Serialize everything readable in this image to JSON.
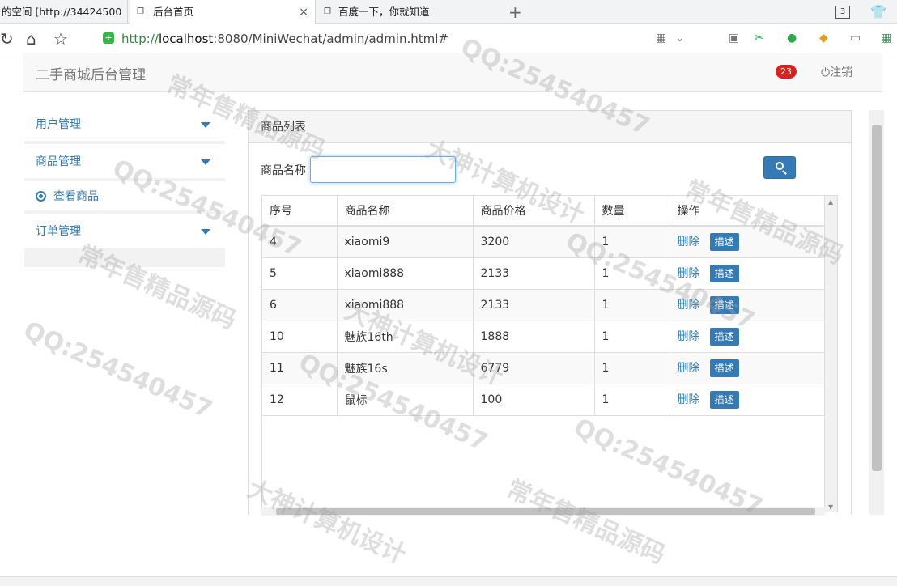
{
  "browser": {
    "tabs": [
      {
        "label": "的空间 [http://34424500"
      },
      {
        "label": "后台首页",
        "close": "×"
      },
      {
        "label": "百度一下，你就知道"
      }
    ],
    "new_tab": "+",
    "tab_count": "3",
    "url_prefix": "http://",
    "url_host": "localhost",
    "url_rest": ":8080/MiniWechat/admin/admin.html#"
  },
  "header": {
    "brand": "二手商城后台管理",
    "badge": "23",
    "logout": "注销"
  },
  "sidebar": {
    "items": [
      {
        "label": "用户管理"
      },
      {
        "label": "商品管理"
      },
      {
        "label": "查看商品"
      },
      {
        "label": "订单管理"
      }
    ]
  },
  "panel": {
    "title": "商品列表",
    "search_label": "商品名称",
    "search_value": ""
  },
  "table": {
    "headers": [
      "序号",
      "商品名称",
      "商品价格",
      "数量",
      "操作"
    ],
    "delete_label": "删除",
    "desc_label": "描述",
    "rows": [
      {
        "id": "4",
        "name": "xiaomi9",
        "price": "3200",
        "qty": "1"
      },
      {
        "id": "5",
        "name": "xiaomi888",
        "price": "2133",
        "qty": "1"
      },
      {
        "id": "6",
        "name": "xiaomi888",
        "price": "2133",
        "qty": "1"
      },
      {
        "id": "10",
        "name": "魅族16th",
        "price": "1888",
        "qty": "1"
      },
      {
        "id": "11",
        "name": "魅族16s",
        "price": "6779",
        "qty": "1"
      },
      {
        "id": "12",
        "name": "鼠标",
        "price": "100",
        "qty": "1"
      }
    ]
  },
  "watermarks": [
    "QQ:254540457",
    "常年售精品源码",
    "大神计算机设计"
  ]
}
